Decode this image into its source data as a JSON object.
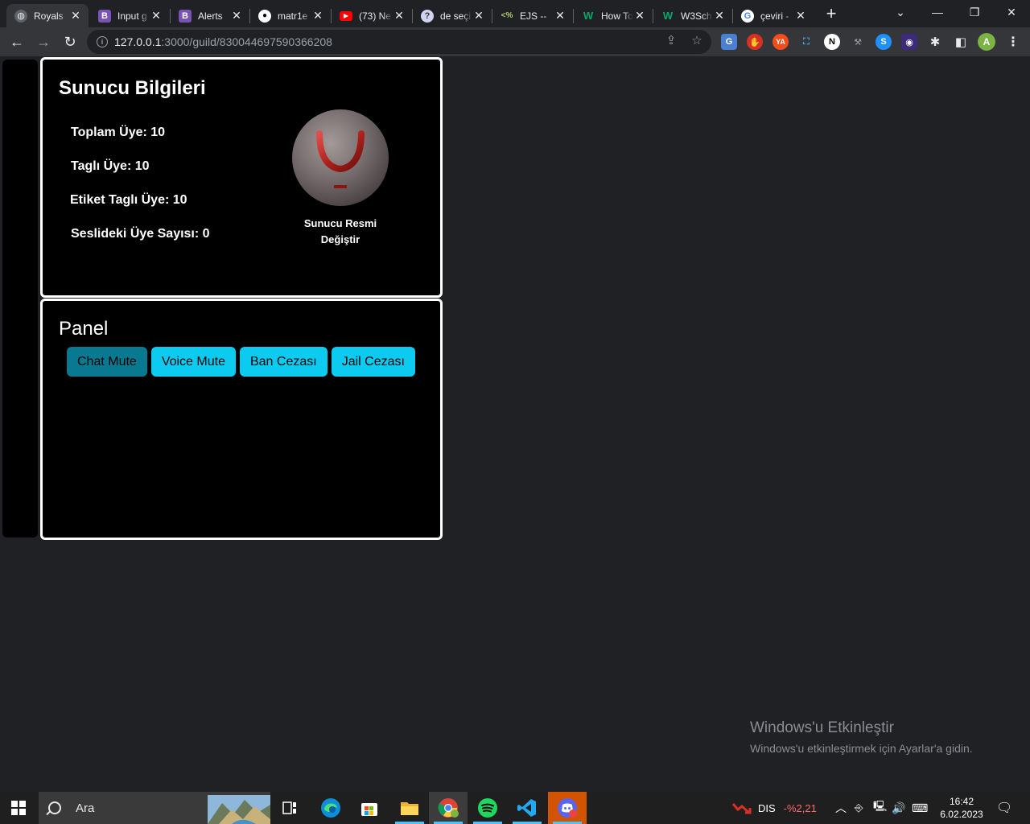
{
  "browser": {
    "tabs": [
      {
        "title": "Royals",
        "favicon": "globe-icon",
        "active": true
      },
      {
        "title": "Input g",
        "favicon": "bootstrap-icon"
      },
      {
        "title": "Alerts",
        "favicon": "bootstrap-icon"
      },
      {
        "title": "matr1e",
        "favicon": "github-icon"
      },
      {
        "title": "(73) Ne",
        "favicon": "youtube-icon"
      },
      {
        "title": "de seçi",
        "favicon": "question-icon"
      },
      {
        "title": "EJS --",
        "favicon": "ejs-icon"
      },
      {
        "title": "How To",
        "favicon": "w3schools-icon"
      },
      {
        "title": "W3Sch",
        "favicon": "w3schools-icon"
      },
      {
        "title": "çeviri -",
        "favicon": "google-icon"
      }
    ],
    "url_host": "127.0.0.1",
    "url_path": ":3000/guild/830044697590366208",
    "profile_initial": "A"
  },
  "server_info": {
    "title": "Sunucu Bilgileri",
    "stats": [
      "Toplam Üye: 10",
      "Taglı Üye: 10",
      "Etiket Taglı Üye: 10",
      "Seslideki Üye Sayısı: 0"
    ],
    "change_icon_label_line1": "Sunucu Resmi",
    "change_icon_label_line2": "Değiştir"
  },
  "panel": {
    "title": "Panel",
    "buttons": [
      "Chat Mute",
      "Voice Mute",
      "Ban Cezası",
      "Jail Cezası"
    ],
    "active_button": "Chat Mute"
  },
  "watermark": {
    "line1": "Windows'u Etkinleştir",
    "line2": "Windows'u etkinleştirmek için Ayarlar'a gidin."
  },
  "taskbar": {
    "search_placeholder": "Ara",
    "stock_name": "DIS",
    "stock_change": "-%2,21",
    "time": "16:42",
    "date": "6.02.2023"
  },
  "colors": {
    "accent_button": "#0dcaf0",
    "active_button": "#087990",
    "page_bg": "#202124",
    "card_bg": "#000000",
    "stock_down": "#ff6b6b"
  }
}
